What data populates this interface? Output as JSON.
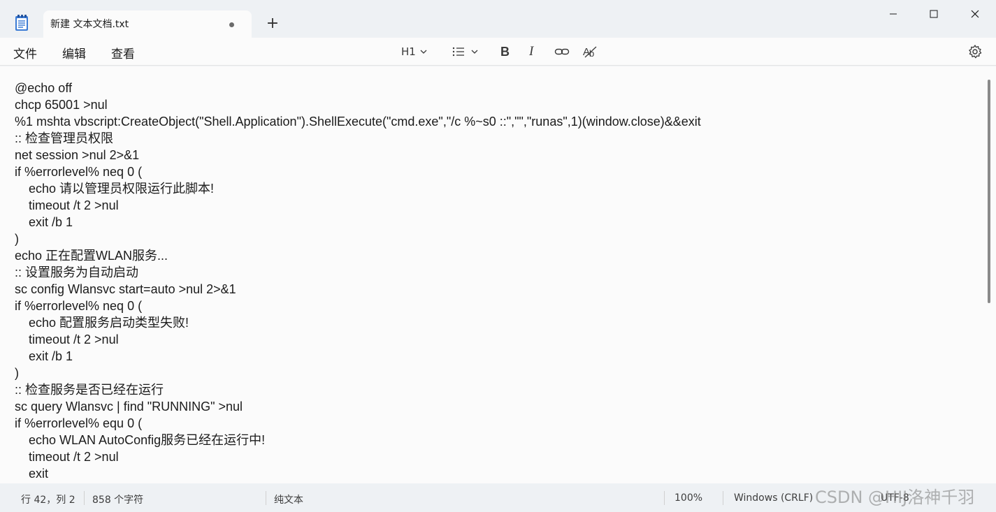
{
  "tab": {
    "title": "新建 文本文档.txt",
    "new_tab_glyph": "+"
  },
  "menu": {
    "file": "文件",
    "edit": "编辑",
    "view": "查看"
  },
  "toolbar": {
    "heading_label": "H1",
    "bold_glyph": "B",
    "italic_glyph": "I"
  },
  "editor": {
    "lines": [
      "@echo off",
      "chcp 65001 >nul",
      "%1 mshta vbscript:CreateObject(\"Shell.Application\").ShellExecute(\"cmd.exe\",\"/c %~s0 ::\",\"\",\"runas\",1)(window.close)&&exit",
      ":: 检查管理员权限",
      "net session >nul 2>&1",
      "if %errorlevel% neq 0 (",
      "    echo 请以管理员权限运行此脚本!",
      "    timeout /t 2 >nul",
      "    exit /b 1",
      ")",
      "echo 正在配置WLAN服务...",
      ":: 设置服务为自动启动",
      "sc config Wlansvc start=auto >nul 2>&1",
      "if %errorlevel% neq 0 (",
      "    echo 配置服务启动类型失败!",
      "    timeout /t 2 >nul",
      "    exit /b 1",
      ")",
      ":: 检查服务是否已经在运行",
      "sc query Wlansvc | find \"RUNNING\" >nul",
      "if %errorlevel% equ 0 (",
      "    echo WLAN AutoConfig服务已经在运行中!",
      "    timeout /t 2 >nul",
      "    exit"
    ]
  },
  "status": {
    "position": "行 42，列 2",
    "char_count": "858 个字符",
    "format": "纯文本",
    "zoom": "100%",
    "line_ending": "Windows (CRLF)",
    "encoding": "UTF-8"
  },
  "watermark": "CSDN @HIJ洛神千羽",
  "colors": {
    "window_bg": "#eef1f4",
    "editor_bg": "#fbfbfb",
    "accent_icon": "#3b7bd4"
  }
}
